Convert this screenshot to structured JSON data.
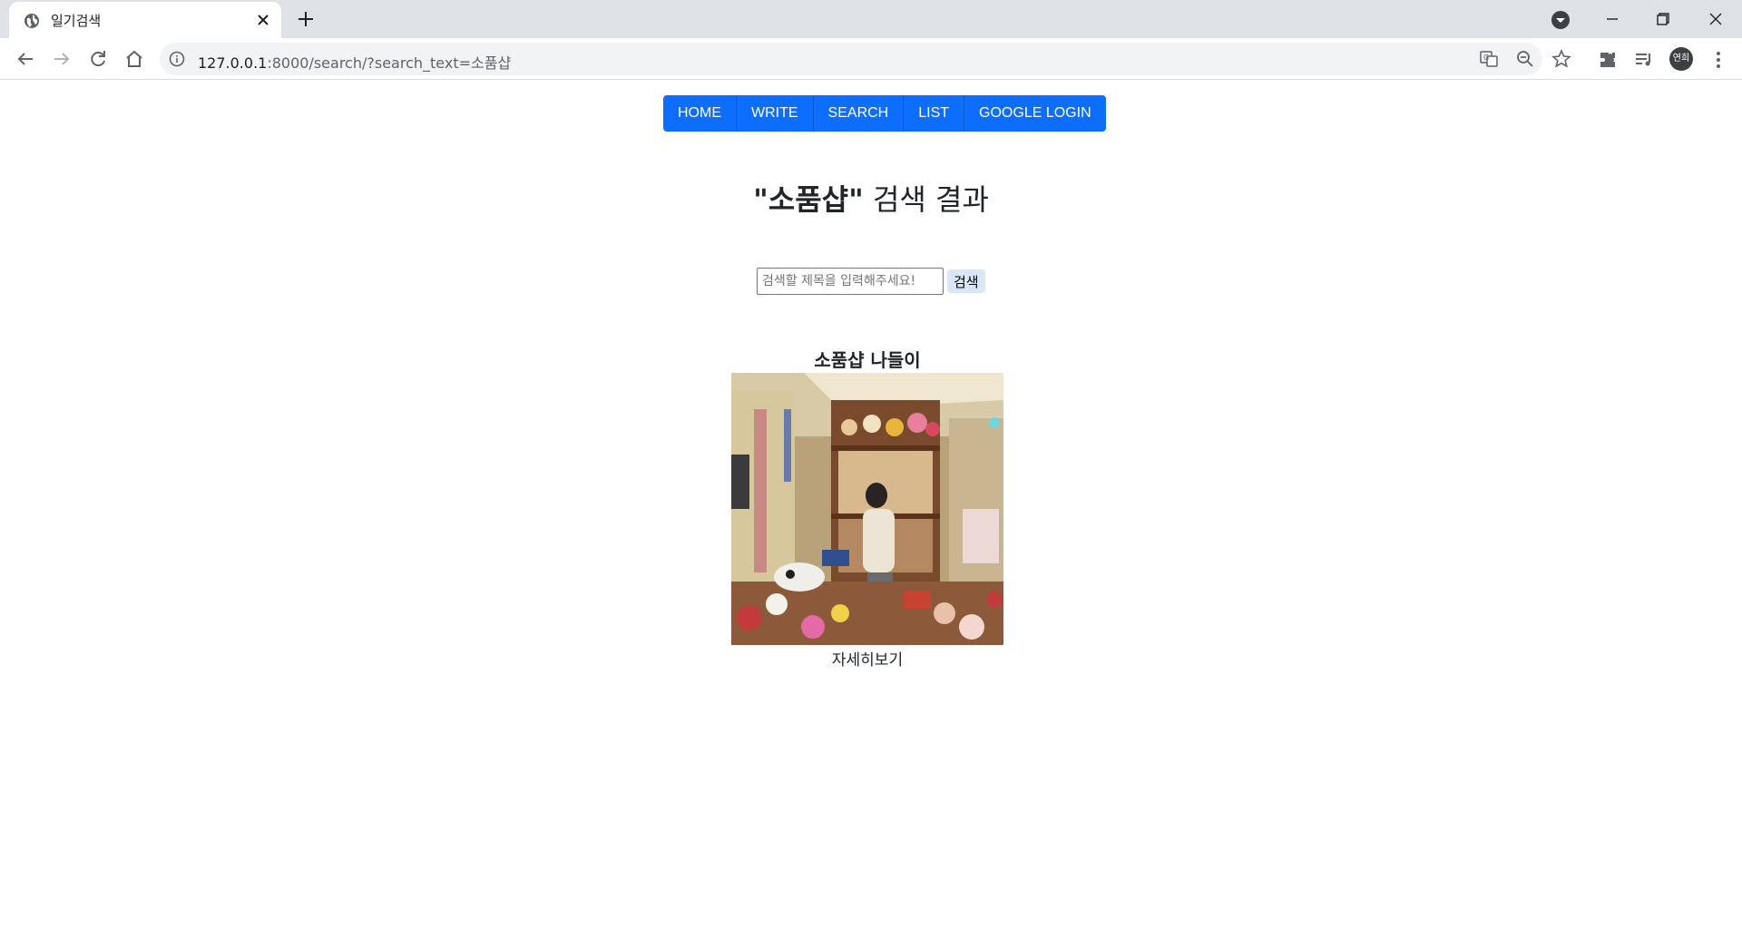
{
  "browser": {
    "tab_title": "일기검색",
    "url_host": "127.0.0.1",
    "url_rest": ":8000/search/?search_text=소품샵",
    "profile_label": "연희"
  },
  "nav": {
    "items": [
      "HOME",
      "WRITE",
      "SEARCH",
      "LIST",
      "GOOGLE LOGIN"
    ],
    "color": "#0d6efd"
  },
  "heading": {
    "query_quoted": "\"소품샵\"",
    "suffix": " 검색 결과"
  },
  "search": {
    "placeholder": "검색할 제목을 입력해주세요!",
    "button_label": "검색"
  },
  "results": [
    {
      "title": "소품샵 나들이",
      "link_label": "자세히보기"
    }
  ]
}
